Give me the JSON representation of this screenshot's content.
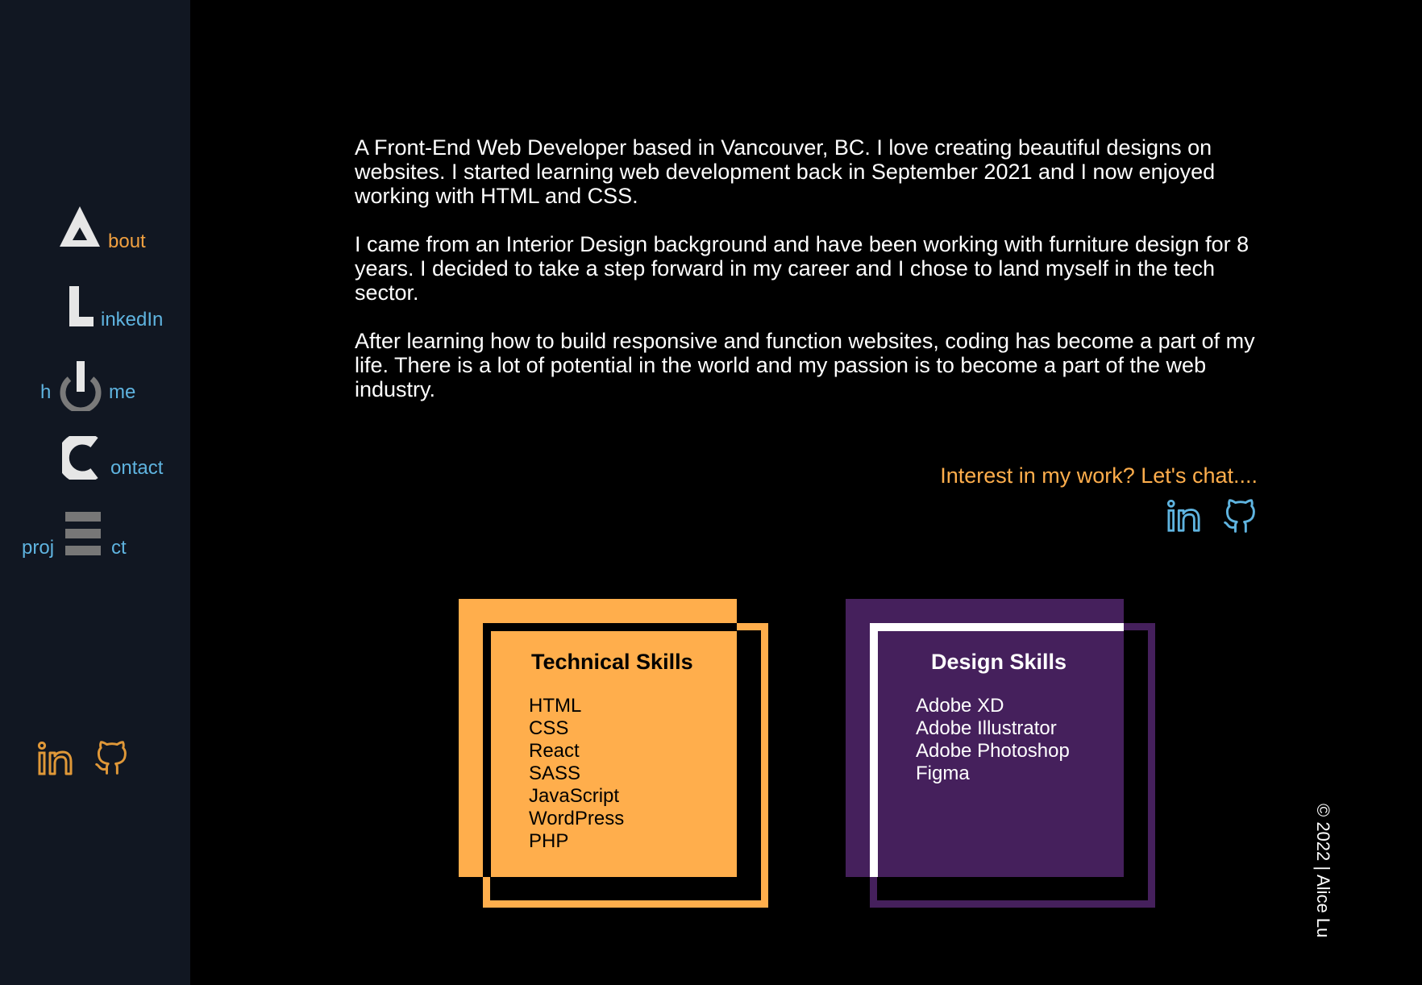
{
  "sidebar": {
    "nav": {
      "about": {
        "letter": "A",
        "label": "bout"
      },
      "linkedin": {
        "letter": "L",
        "label": "inkedIn"
      },
      "home": {
        "prefix": "h",
        "label": "me"
      },
      "contact": {
        "letter": "C",
        "label": "ontact"
      },
      "projects": {
        "prefix": "proj",
        "label": "ct"
      }
    },
    "social": [
      {
        "icon": "linkedin-icon"
      },
      {
        "icon": "github-icon"
      }
    ]
  },
  "intro": {
    "paragraphs": [
      "A Front-End Web Developer based in Vancouver, BC. I love creating beautiful designs on websites. I started learning web development back in September 2021 and I now enjoyed working with HTML and CSS.",
      "I came from an Interior Design background and have been working with furniture design for 8 years. I decided to take a step forward in my career and I chose to land myself in the tech sector.",
      "After learning how to build responsive and function websites, coding has become a part of my life. There is a lot of potential in the world and my passion is to become a part of the web industry."
    ]
  },
  "contact": {
    "prompt": "Interest in my work? Let's chat....",
    "social": [
      {
        "icon": "linkedin-icon"
      },
      {
        "icon": "github-icon"
      }
    ]
  },
  "skills": {
    "technical": {
      "title": "Technical Skills",
      "items": [
        "HTML",
        "CSS",
        "React",
        "SASS",
        "JavaScript",
        "WordPress",
        "PHP"
      ]
    },
    "design": {
      "title": "Design Skills",
      "items": [
        "Adobe XD",
        "Adobe Illustrator",
        "Adobe Photoshop",
        "Figma"
      ]
    }
  },
  "footer": {
    "copyright": "© 2022 | Alice Lu"
  },
  "colors": {
    "sidebar_bg": "#111722",
    "accent_orange": "#FFAE4C",
    "accent_blue": "#5FB4E0",
    "accent_purple": "#45205C",
    "icon_gray": "#777777"
  }
}
